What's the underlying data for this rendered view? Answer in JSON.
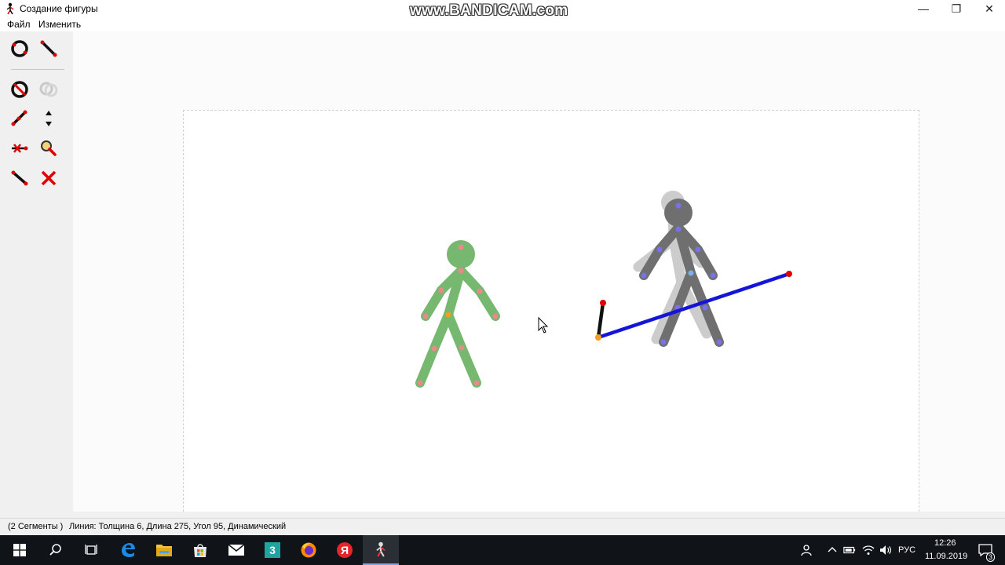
{
  "window": {
    "title": "Создание фигуры",
    "watermark": "www.BANDICAM.com",
    "minimize_glyph": "—",
    "restore_glyph": "❐",
    "close_glyph": "✕"
  },
  "menu": {
    "file": "Файл",
    "edit": "Изменить"
  },
  "toolbox": {
    "tools": [
      "circle-tool",
      "line-tool",
      "remove-circle-tool",
      "copy-circle-tool",
      "attach-tool",
      "move-up-down-tool",
      "detach-tool",
      "zoom-tool",
      "segment-tool",
      "delete-tool"
    ],
    "colors": {
      "red": "#e00000",
      "black": "#111111",
      "gray": "#b8b8b8"
    }
  },
  "status": {
    "segments": "(2 Сегменты )",
    "line_info": "Линия: Толщина 6, Длина 275, Угол 95, Динамический"
  },
  "colors": {
    "green_figure": "#76b86f",
    "gray_figure": "#6f6f6f",
    "ghost_figure": "#cccccc",
    "blue_line": "#1515d8",
    "joint_red": "#e00000",
    "joint_orange": "#f0a020",
    "joint_pink": "#e88a8a",
    "joint_blue": "#7a70e8",
    "taskbar": "#101317"
  },
  "taskbar": {
    "apps": [
      "start-icon",
      "search-icon",
      "task-view-icon",
      "edge-icon",
      "explorer-icon",
      "store-icon",
      "mail-icon",
      "app-3-icon",
      "firefox-icon",
      "yandex-icon",
      "stick-figure-app-icon"
    ],
    "language": "РУС",
    "time": "12:26",
    "date": "11.09.2019",
    "notifications": "3"
  }
}
